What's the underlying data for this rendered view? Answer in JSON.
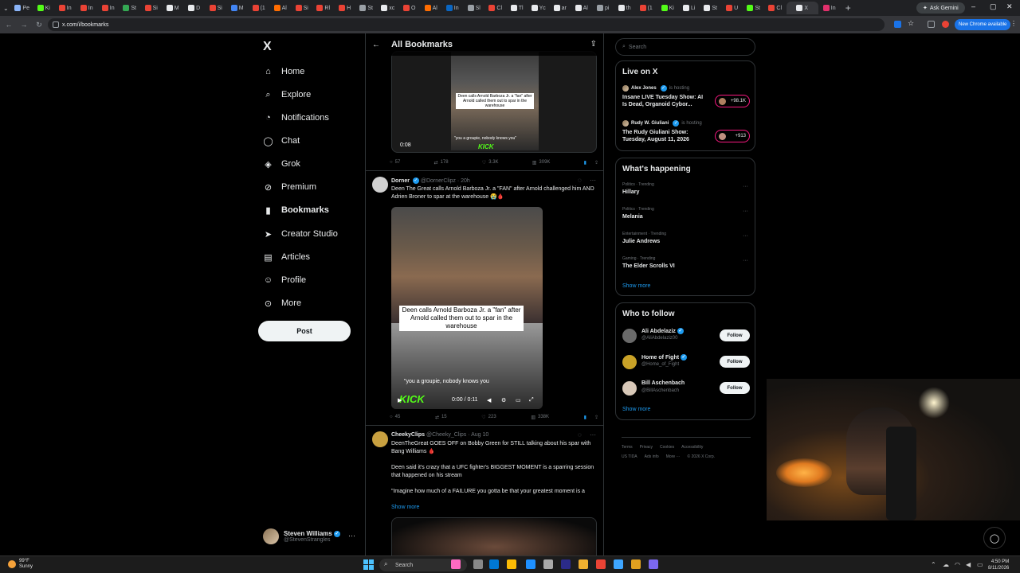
{
  "browser": {
    "tabs": [
      "Pe",
      "Ki",
      "In",
      "In",
      "In",
      "St",
      "Si",
      "M",
      "D",
      "Si",
      "M",
      "(1",
      "Al",
      "Si",
      "Rl",
      "H",
      "St",
      "xc",
      "O",
      "Al",
      "In",
      "Sl",
      "Cl",
      "Tl",
      "Yc",
      "ar",
      "Al",
      "pi",
      "th",
      "(1",
      "Ki",
      "Li",
      "St",
      "U",
      "St",
      "Cl",
      "X",
      "In"
    ],
    "tab_colors": [
      "#8ab4f8",
      "#53fc18",
      "#ea4335",
      "#ea4335",
      "#ea4335",
      "#34a853",
      "#ea4335",
      "#e8eaed",
      "#e8eaed",
      "#ea4335",
      "#4285f4",
      "#ea4335",
      "#ff6d01",
      "#ea4335",
      "#ea4335",
      "#ea4335",
      "#9aa0a6",
      "#e8eaed",
      "#ea4335",
      "#ff6d01",
      "#0a66c2",
      "#9aa0a6",
      "#ea4335",
      "#e8eaed",
      "#e8eaed",
      "#e8eaed",
      "#e8eaed",
      "#9aa0a6",
      "#e8eaed",
      "#ea4335",
      "#53fc18",
      "#e8eaed",
      "#e8eaed",
      "#ea4335",
      "#53fc18",
      "#ea4335",
      "#e8eaed",
      "#e1306c"
    ],
    "active_tab": "X",
    "ask_gemini": "Ask Gemini",
    "url": "x.com/i/bookmarks",
    "new_chrome": "New Chrome available"
  },
  "nav": {
    "logo": "X",
    "items": [
      {
        "label": "Home",
        "icon": "home-icon"
      },
      {
        "label": "Explore",
        "icon": "search-icon"
      },
      {
        "label": "Notifications",
        "icon": "bell-icon"
      },
      {
        "label": "Chat",
        "icon": "chat-icon"
      },
      {
        "label": "Grok",
        "icon": "grok-icon"
      },
      {
        "label": "Premium",
        "icon": "premium-icon"
      },
      {
        "label": "Bookmarks",
        "icon": "bookmark-icon"
      },
      {
        "label": "Creator Studio",
        "icon": "creator-studio-icon"
      },
      {
        "label": "Articles",
        "icon": "articles-icon"
      },
      {
        "label": "Profile",
        "icon": "profile-icon"
      },
      {
        "label": "More",
        "icon": "more-icon"
      }
    ],
    "post_button": "Post",
    "account": {
      "name": "Steven Williams",
      "handle": "@StevenStrangles"
    }
  },
  "feed": {
    "title": "All Bookmarks",
    "post1": {
      "caption": "Deen calls Arnold Barboza Jr. a \"fan\" after Arnold called them out to spar in the warehouse",
      "subcaption": "\"you a groupie, nobody knows you\"",
      "time": "0:08",
      "kick": "KICK",
      "stats": {
        "replies": "57",
        "reposts": "178",
        "likes": "3.3K",
        "views": "309K"
      }
    },
    "post2": {
      "name": "Dorner",
      "handle": "@DornerClipz",
      "age": "· 20h",
      "text": "Deen The Great calls Arnold Barboza Jr. a \"FAN\" after Arnold challenged him AND Adrien Broner to spar at the warehouse 😭🩸",
      "caption": "Deen calls Arnold Barboza Jr. a \"fan\" after Arnold called them out to spar in the warehouse",
      "subcaption": "\"you a groupie, nobody knows you",
      "kick": "KICK",
      "timecode": "0:00 / 0:11",
      "stats": {
        "replies": "45",
        "reposts": "15",
        "likes": "223",
        "views": "338K"
      }
    },
    "post3": {
      "name": "CheekyClips",
      "handle": "@Cheeky_Clips",
      "age": "· Aug 10",
      "text1": "DeenTheGreat GOES OFF on Bobby Green for STILL talking about his spar with Bang Williams 🩸",
      "text2": "Deen said it's crazy that a UFC fighter's BIGGEST MOMENT is a sparring session that happened on his stream",
      "text3": "\"Imagine how much of a FAILURE you gotta be that your greatest moment is a",
      "show_more": "Show more"
    }
  },
  "sidebar": {
    "search_placeholder": "Search",
    "live": {
      "title": "Live on X",
      "items": [
        {
          "host": "Alex Jones",
          "status": "is hosting",
          "title": "Insane LIVE Tuesday Show: AI Is Dead, Organoid Cybor...",
          "count": "+98.1K"
        },
        {
          "host": "Rudy W. Giuliani",
          "status": "is hosting",
          "title": "The Rudy Giuliani Show: Tuesday, August 11, 2026",
          "count": "+913"
        }
      ]
    },
    "happening": {
      "title": "What's happening",
      "items": [
        {
          "meta": "Politics · Trending",
          "name": "Hillary"
        },
        {
          "meta": "Politics · Trending",
          "name": "Melania"
        },
        {
          "meta": "Entertainment · Trending",
          "name": "Julie Andrews"
        },
        {
          "meta": "Gaming · Trending",
          "name": "The Elder Scrolls VI"
        }
      ],
      "show_more": "Show more"
    },
    "follow": {
      "title": "Who to follow",
      "items": [
        {
          "name": "Ali Abdelaziz",
          "handle": "@AliAbdelaziz00"
        },
        {
          "name": "Home of Fight",
          "handle": "@Home_of_Fight"
        },
        {
          "name": "Bill Aschenbach",
          "handle": "@BillAschenbach"
        }
      ],
      "button": "Follow",
      "show_more": "Show more"
    },
    "footer": {
      "line1": [
        "Terms",
        "Privacy",
        "Cookies",
        "Accessibility"
      ],
      "line2": [
        "US TIDA",
        "Ads info",
        "More ···",
        "© 2026 X Corp."
      ]
    }
  },
  "taskbar": {
    "weather_temp": "99°F",
    "weather_desc": "Sunny",
    "search": "Search",
    "time": "4:50 PM",
    "date": "8/11/2026"
  }
}
